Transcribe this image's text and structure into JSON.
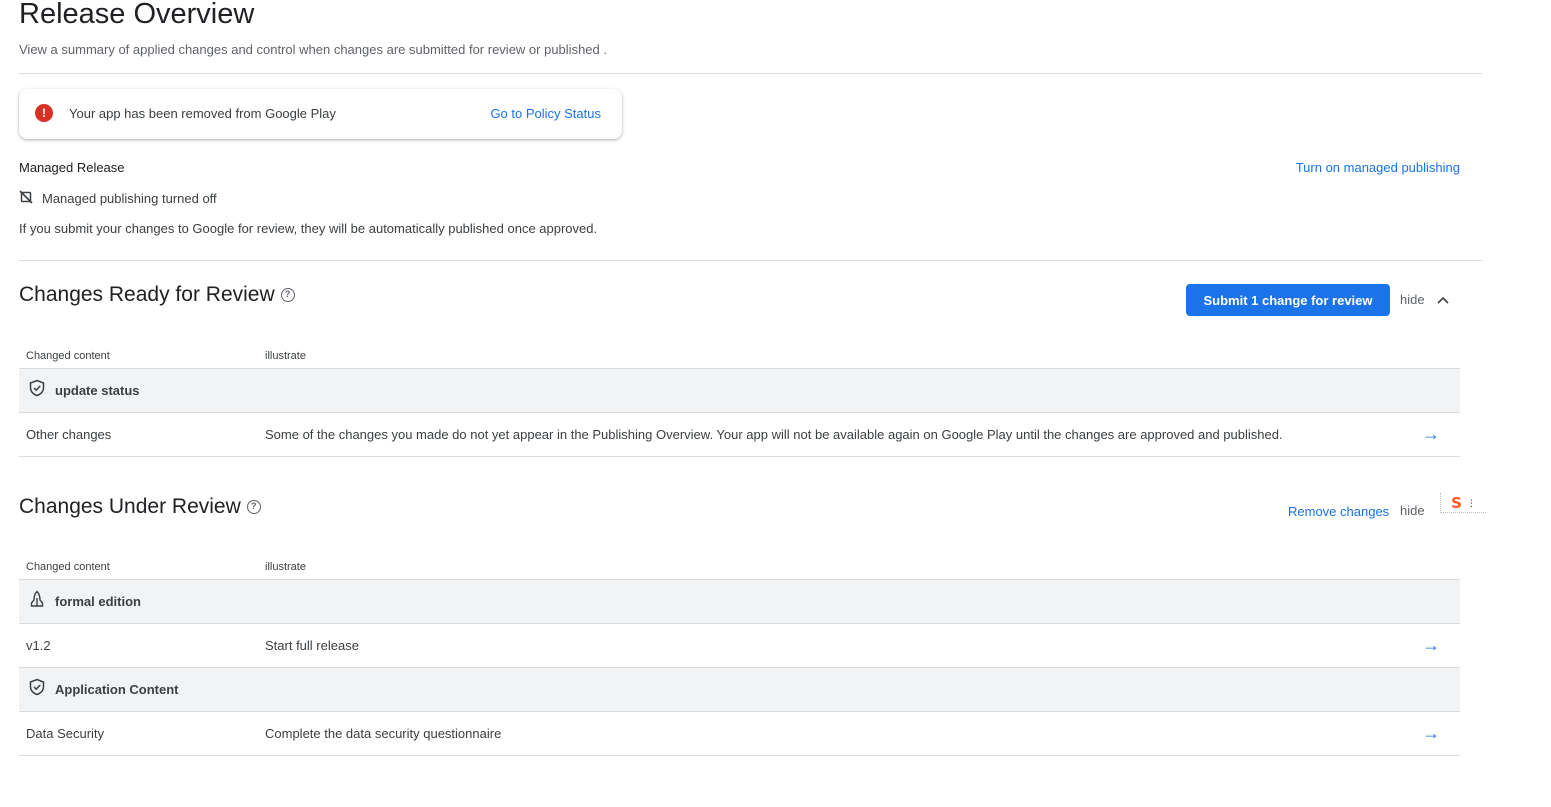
{
  "header": {
    "title": "Release Overview",
    "subtitle": "View a summary of applied changes and control when changes are submitted for review or published  ."
  },
  "alert": {
    "icon": "error-icon",
    "message": "Your app has been removed from Google Play",
    "link_label": "Go to Policy Status",
    "color": "#d93025"
  },
  "managed": {
    "heading": "Managed Release",
    "turn_on_label": "Turn on managed publishing",
    "status_icon": "sync-disabled-icon",
    "status": "Managed publishing turned off",
    "description": "If you submit your changes to Google for review, they will be automatically published once approved."
  },
  "ready_section": {
    "title": "Changes Ready for Review",
    "submit_label": "Submit 1 change for review",
    "hide_label": "hide",
    "columns": [
      "Changed content",
      "illustrate"
    ],
    "groups": [
      {
        "icon": "shield-check-icon",
        "label": "update status",
        "rows": [
          {
            "content": "Other changes",
            "description": "Some of the changes you made do not yet appear in the Publishing Overview. Your app will not be available again on Google Play until the changes are approved and published."
          }
        ]
      }
    ]
  },
  "review_section": {
    "title": "Changes Under Review",
    "remove_label": "Remove changes",
    "hide_label": "hide",
    "columns": [
      "Changed content",
      "illustrate"
    ],
    "groups": [
      {
        "icon": "rocket-icon",
        "label": "formal edition",
        "rows": [
          {
            "content": "v1.2",
            "description": "Start full release"
          }
        ]
      },
      {
        "icon": "shield-check-icon",
        "label": "Application Content",
        "rows": [
          {
            "content": "Data Security",
            "description": "Complete the data security questionnaire"
          }
        ]
      }
    ]
  },
  "colors": {
    "accent": "#1a73e8",
    "group_bg": "#f1f3f4",
    "divider": "#dadce0"
  }
}
